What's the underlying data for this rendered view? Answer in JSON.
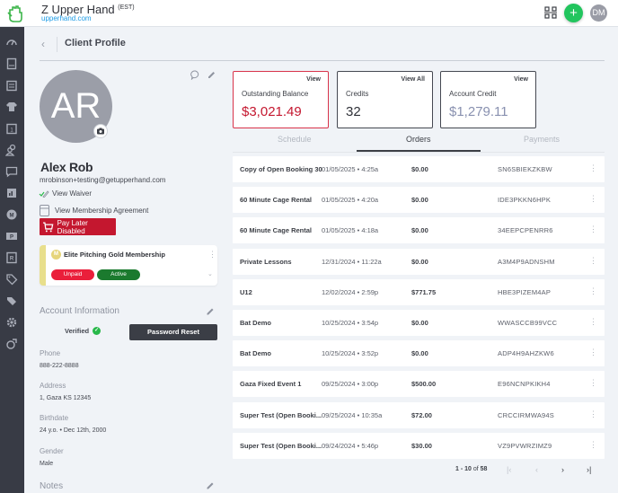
{
  "app": {
    "name": "Z Upper Hand",
    "timezone": "(EST)",
    "url": "upperhand.com",
    "user_initials": "DM",
    "add_label": "+"
  },
  "sidebar": {
    "items": [
      {
        "icon": "dashboard-icon"
      },
      {
        "icon": "book-icon"
      },
      {
        "icon": "calendar-icon"
      },
      {
        "icon": "shirt-icon"
      },
      {
        "icon": "calendar-day-icon"
      },
      {
        "icon": "clients-icon"
      },
      {
        "icon": "messages-icon"
      },
      {
        "icon": "reports-icon"
      },
      {
        "icon": "memberships-icon"
      },
      {
        "icon": "pass-icon"
      },
      {
        "icon": "resources-icon"
      },
      {
        "icon": "tag-icon"
      },
      {
        "icon": "tags-icon"
      },
      {
        "icon": "settings-icon"
      },
      {
        "icon": "staff-settings-icon"
      }
    ]
  },
  "header": {
    "back": "‹",
    "title": "Client Profile"
  },
  "profile": {
    "initials": "AR",
    "name": "Alex Rob",
    "email": "mrobinson+testing@getupperhand.com",
    "view_waiver": "View Waiver",
    "view_agreement": "View Membership Agreement",
    "pay_later": "Pay Later Disabled"
  },
  "membership": {
    "icon_letter": "M",
    "title": "Elite Pitching Gold Membership",
    "payment_status": "Unpaid",
    "status": "Active"
  },
  "account": {
    "title": "Account Information",
    "verified": "Verified",
    "password_reset": "Password Reset",
    "fields": [
      {
        "label": "Phone",
        "value": "888-222-8888"
      },
      {
        "label": "Address",
        "value": "1, Gaza KS 12345"
      },
      {
        "label": "Birthdate",
        "value": "24 y.o. • Dec 12th, 2000"
      },
      {
        "label": "Gender",
        "value": "Male"
      }
    ],
    "notes_title": "Notes"
  },
  "stats": [
    {
      "link": "View",
      "label": "Outstanding Balance",
      "value": "$3,021.49",
      "color": "#c4172f"
    },
    {
      "link": "View All",
      "label": "Credits",
      "value": "32",
      "color": "#2f3138"
    },
    {
      "link": "View",
      "label": "Account Credit",
      "value": "$1,279.11",
      "color": "#8991b0"
    }
  ],
  "tabs": [
    {
      "label": "Schedule",
      "active": false
    },
    {
      "label": "Orders",
      "active": true
    },
    {
      "label": "Payments",
      "active": false
    }
  ],
  "orders": [
    {
      "name": "Copy of Open Booking 30",
      "date": "01/05/2025 • 4:25a",
      "amount": "$0.00",
      "code": "SN6SBIEKZKBW"
    },
    {
      "name": "60 Minute Cage Rental",
      "date": "01/05/2025 • 4:20a",
      "amount": "$0.00",
      "code": "IDE3PKKN6HPK"
    },
    {
      "name": "60 Minute Cage Rental",
      "date": "01/05/2025 • 4:18a",
      "amount": "$0.00",
      "code": "34EEPCPENRR6"
    },
    {
      "name": "Private Lessons",
      "date": "12/31/2024 • 11:22a",
      "amount": "$0.00",
      "code": "A3M4P9ADNSHM"
    },
    {
      "name": "U12",
      "date": "12/02/2024 • 2:59p",
      "amount": "$771.75",
      "code": "HBE3PIZEM4AP"
    },
    {
      "name": "Bat Demo",
      "date": "10/25/2024 • 3:54p",
      "amount": "$0.00",
      "code": "WWASCCB99VCC"
    },
    {
      "name": "Bat Demo",
      "date": "10/25/2024 • 3:52p",
      "amount": "$0.00",
      "code": "ADP4H9AHZKW6"
    },
    {
      "name": "Gaza Fixed Event 1",
      "date": "09/25/2024 • 3:00p",
      "amount": "$500.00",
      "code": "E96NCNPKIKH4"
    },
    {
      "name": "Super Test (Open Booki...",
      "date": "09/25/2024 • 10:35a",
      "amount": "$72.00",
      "code": "CRCCIRMWA94S"
    },
    {
      "name": "Super Test (Open Booki...",
      "date": "09/24/2024 • 5:46p",
      "amount": "$30.00",
      "code": "VZ9PVWRZIMZ9"
    }
  ],
  "pagination": {
    "range": "1 - 10",
    "of": "of",
    "total": "58",
    "first": "|‹",
    "prev": "‹",
    "next": "›",
    "last": "›|"
  }
}
